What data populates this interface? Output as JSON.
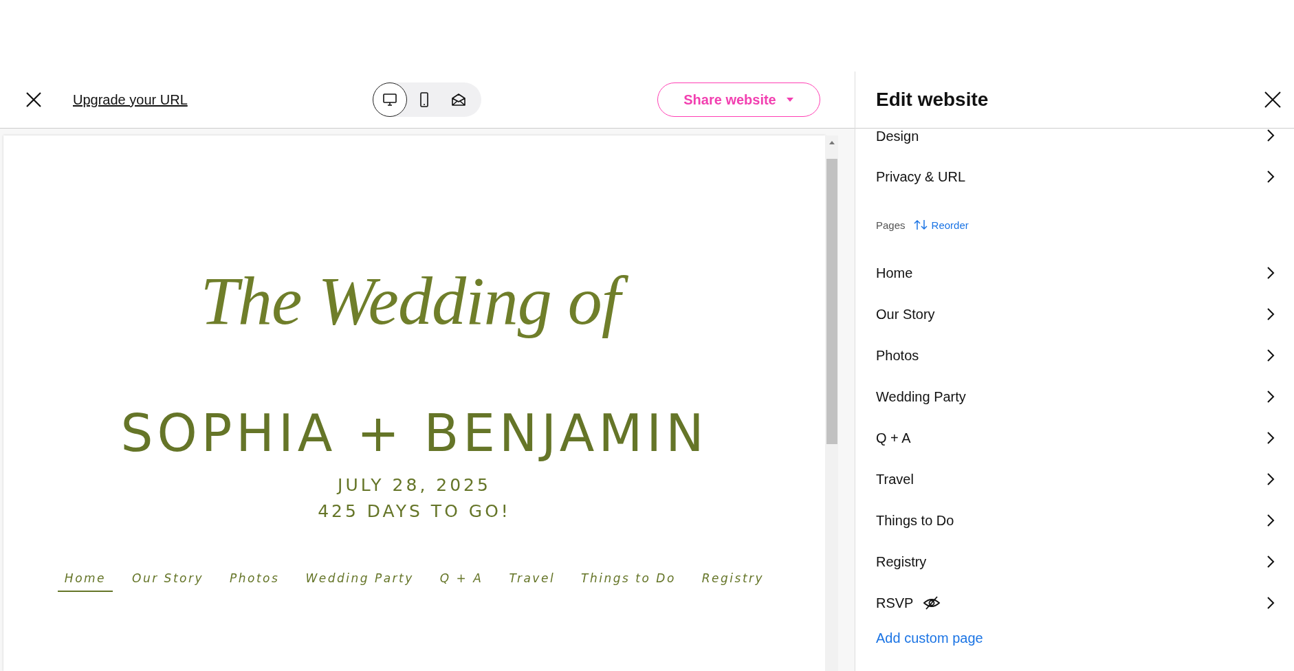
{
  "toolbar": {
    "upgrade_link": "Upgrade your URL",
    "devices": [
      {
        "kind": "desktop",
        "selected": true
      },
      {
        "kind": "phone",
        "selected": false
      },
      {
        "kind": "envelope",
        "selected": false
      }
    ],
    "share_button": "Share website"
  },
  "preview": {
    "script_title": "The Wedding of",
    "names": "SOPHIA + BENJAMIN",
    "date": "JULY 28, 2025",
    "countdown": "425 DAYS TO GO!",
    "nav": [
      {
        "label": "Home",
        "selected": true
      },
      {
        "label": "Our Story",
        "selected": false
      },
      {
        "label": "Photos",
        "selected": false
      },
      {
        "label": "Wedding Party",
        "selected": false
      },
      {
        "label": "Q + A",
        "selected": false
      },
      {
        "label": "Travel",
        "selected": false
      },
      {
        "label": "Things to Do",
        "selected": false
      },
      {
        "label": "Registry",
        "selected": false
      }
    ]
  },
  "panel": {
    "title": "Edit website",
    "settings": [
      {
        "label": "Design"
      },
      {
        "label": "Privacy & URL"
      }
    ],
    "pages_label": "Pages",
    "reorder_link": "Reorder",
    "pages": [
      {
        "label": "Home",
        "hidden": false
      },
      {
        "label": "Our Story",
        "hidden": false
      },
      {
        "label": "Photos",
        "hidden": false
      },
      {
        "label": "Wedding Party",
        "hidden": false
      },
      {
        "label": "Q + A",
        "hidden": false
      },
      {
        "label": "Travel",
        "hidden": false
      },
      {
        "label": "Things to Do",
        "hidden": false
      },
      {
        "label": "Registry",
        "hidden": false
      },
      {
        "label": "RSVP",
        "hidden": true
      }
    ],
    "add_link": "Add custom page"
  }
}
